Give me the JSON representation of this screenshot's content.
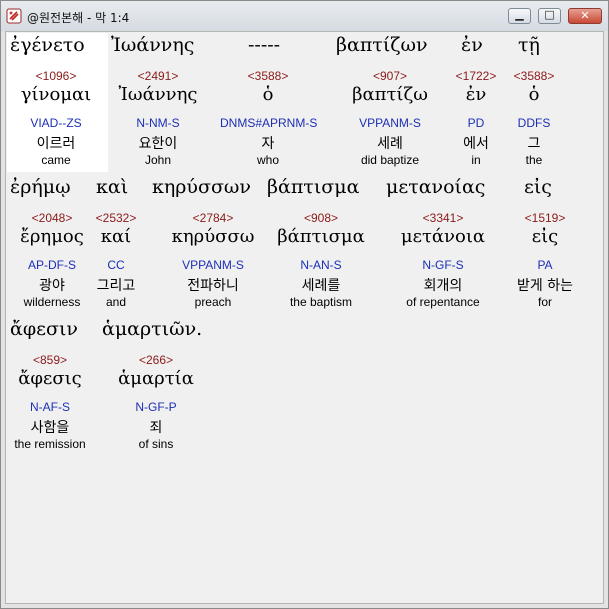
{
  "window": {
    "title": "@원전본해 - 막 1:4",
    "buttons": {
      "minimize": "▁",
      "maximize": "□",
      "close": "✕"
    }
  },
  "words": [
    {
      "greek": "ἐγένετο",
      "strong": "<1096>",
      "lemma": "γίνομαι",
      "parse": "VIAD--ZS",
      "korean": "이르러",
      "english": "came"
    },
    {
      "greek": "Ἰωάννης",
      "strong": "<2491>",
      "lemma": "Ἰωάννης",
      "parse": "N-NM-S",
      "korean": "요한이",
      "english": "John"
    },
    {
      "greek": "-----",
      "strong": "<3588>",
      "lemma": "ὁ",
      "parse": "DNMS#APRNM-S",
      "korean": "자",
      "english": "who"
    },
    {
      "greek": "βαπτίζων",
      "strong": "<907>",
      "lemma": "βαπτίζω",
      "parse": "VPPANM-S",
      "korean": "세례",
      "english": "did baptize"
    },
    {
      "greek": "ἐν",
      "strong": "<1722>",
      "lemma": "ἐν",
      "parse": "PD",
      "korean": "에서",
      "english": "in"
    },
    {
      "greek": "τῇ",
      "strong": "<3588>",
      "lemma": "ὁ",
      "parse": "DDFS",
      "korean": "그",
      "english": "the"
    },
    {
      "greek": "ἐρήμῳ",
      "strong": "<2048>",
      "lemma": "ἔρημος",
      "parse": "AP-DF-S",
      "korean": "광야",
      "english": "wilderness"
    },
    {
      "greek": "καὶ",
      "strong": "<2532>",
      "lemma": "καί",
      "parse": "CC",
      "korean": "그리고",
      "english": "and"
    },
    {
      "greek": "κηρύσσων",
      "strong": "<2784>",
      "lemma": "κηρύσσω",
      "parse": "VPPANM-S",
      "korean": "전파하니",
      "english": "preach"
    },
    {
      "greek": "βάπτισμα",
      "strong": "<908>",
      "lemma": "βάπτισμα",
      "parse": "N-AN-S",
      "korean": "세례를",
      "english": "the baptism"
    },
    {
      "greek": "μετανοίας",
      "strong": "<3341>",
      "lemma": "μετάνοια",
      "parse": "N-GF-S",
      "korean": "회개의",
      "english": "of repentance"
    },
    {
      "greek": "εἰς",
      "strong": "<1519>",
      "lemma": "εἰς",
      "parse": "PA",
      "korean": "받게 하는",
      "english": "for"
    },
    {
      "greek": "ἄφεσιν",
      "strong": "<859>",
      "lemma": "ἄφεσις",
      "parse": "N-AF-S",
      "korean": "사함을",
      "english": "the remission"
    },
    {
      "greek": "ἁμαρτιῶν.",
      "strong": "<266>",
      "lemma": "ἁμαρτία",
      "parse": "N-GF-P",
      "korean": "죄",
      "english": "of sins"
    }
  ]
}
